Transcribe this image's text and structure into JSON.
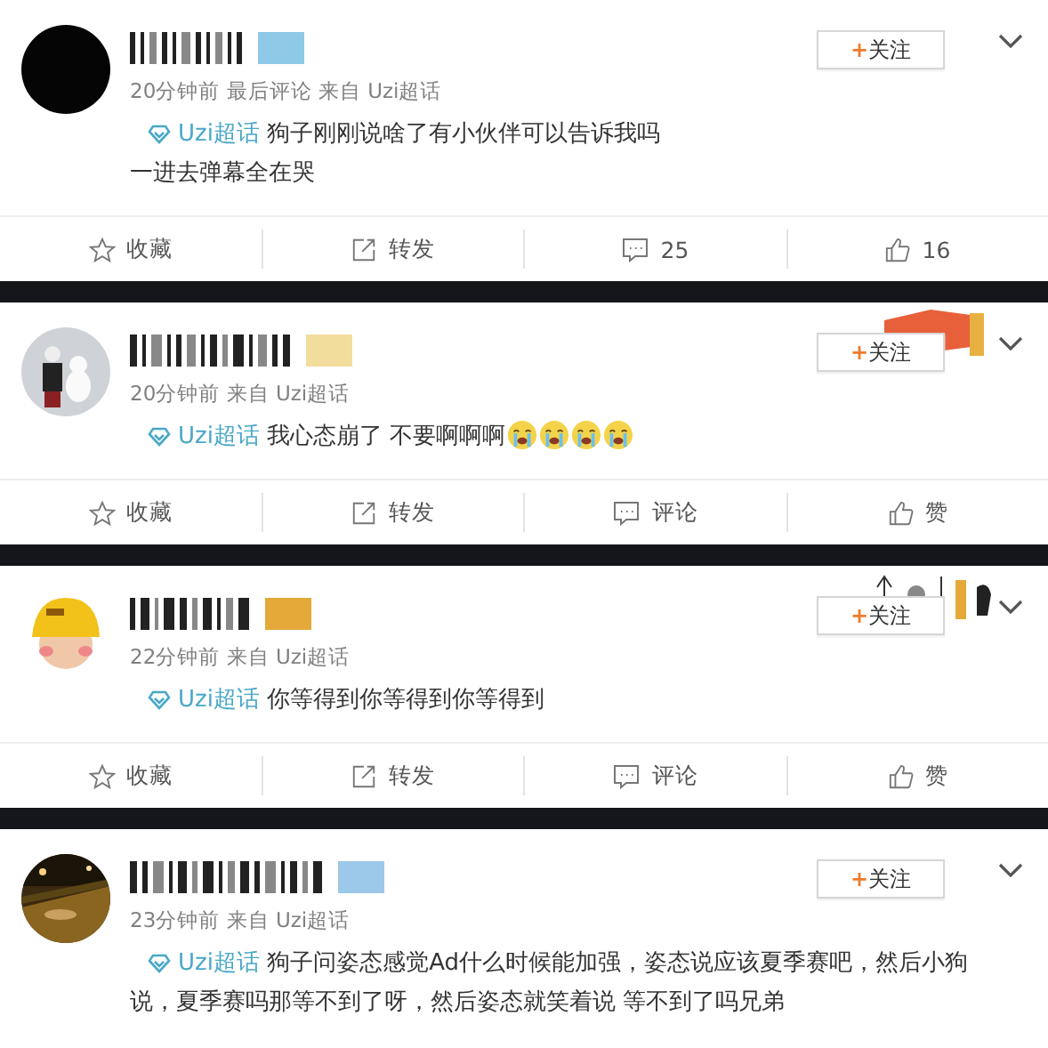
{
  "posts": [
    {
      "avatar": {
        "kind": "dark"
      },
      "badge": {
        "color": "#8ec9e8"
      },
      "follow": {
        "plus": "+",
        "label": "关注"
      },
      "meta": "20分钟前 最后评论 来自 Uzi超话",
      "topic": "Uzi超话",
      "text": "狗子刚刚说啥了有小伙伴可以告诉我吗",
      "extra_line": "一进去弹幕全在哭",
      "actions": [
        {
          "kind": "star",
          "label": "收藏"
        },
        {
          "kind": "share",
          "label": "转发"
        },
        {
          "kind": "comment",
          "label": "25"
        },
        {
          "kind": "like",
          "label": "16"
        }
      ]
    },
    {
      "avatar": {
        "kind": "figures"
      },
      "badge": {
        "color": "#f3dd9c"
      },
      "sticker": {
        "kind": "flag"
      },
      "follow": {
        "plus": "+",
        "label": "关注"
      },
      "meta": "20分钟前 来自 Uzi超话",
      "topic": "Uzi超话",
      "text": "我心态崩了 不要啊啊啊",
      "emojis": [
        {
          "kind": "crying"
        },
        {
          "kind": "crying"
        },
        {
          "kind": "crying"
        },
        {
          "kind": "crying"
        }
      ],
      "actions": [
        {
          "kind": "star",
          "label": "收藏"
        },
        {
          "kind": "share",
          "label": "转发"
        },
        {
          "kind": "comment",
          "label": "评论"
        },
        {
          "kind": "like",
          "label": "赞"
        }
      ]
    },
    {
      "avatar": {
        "kind": "helmet"
      },
      "badge": {
        "color": "#e5a93a"
      },
      "sticker": {
        "kind": "figures"
      },
      "follow": {
        "plus": "+",
        "label": "关注"
      },
      "meta": "22分钟前 来自 Uzi超话",
      "topic": "Uzi超话",
      "text": "你等得到你等得到你等得到",
      "actions": [
        {
          "kind": "star",
          "label": "收藏"
        },
        {
          "kind": "share",
          "label": "转发"
        },
        {
          "kind": "comment",
          "label": "评论"
        },
        {
          "kind": "like",
          "label": "赞"
        }
      ]
    },
    {
      "badge": {
        "color": "#9cc8ea"
      },
      "follow": {
        "plus": "+",
        "label": "关注"
      },
      "meta": "23分钟前 来自 Uzi超话",
      "topic": "Uzi超话",
      "text": "狗子问姿态感觉Ad什么时候能加强，姿态说应该夏季赛吧，然后小狗说，夏季赛吗那等不到了呀，然后姿态就笑着说 等不到了吗兄弟"
    }
  ]
}
